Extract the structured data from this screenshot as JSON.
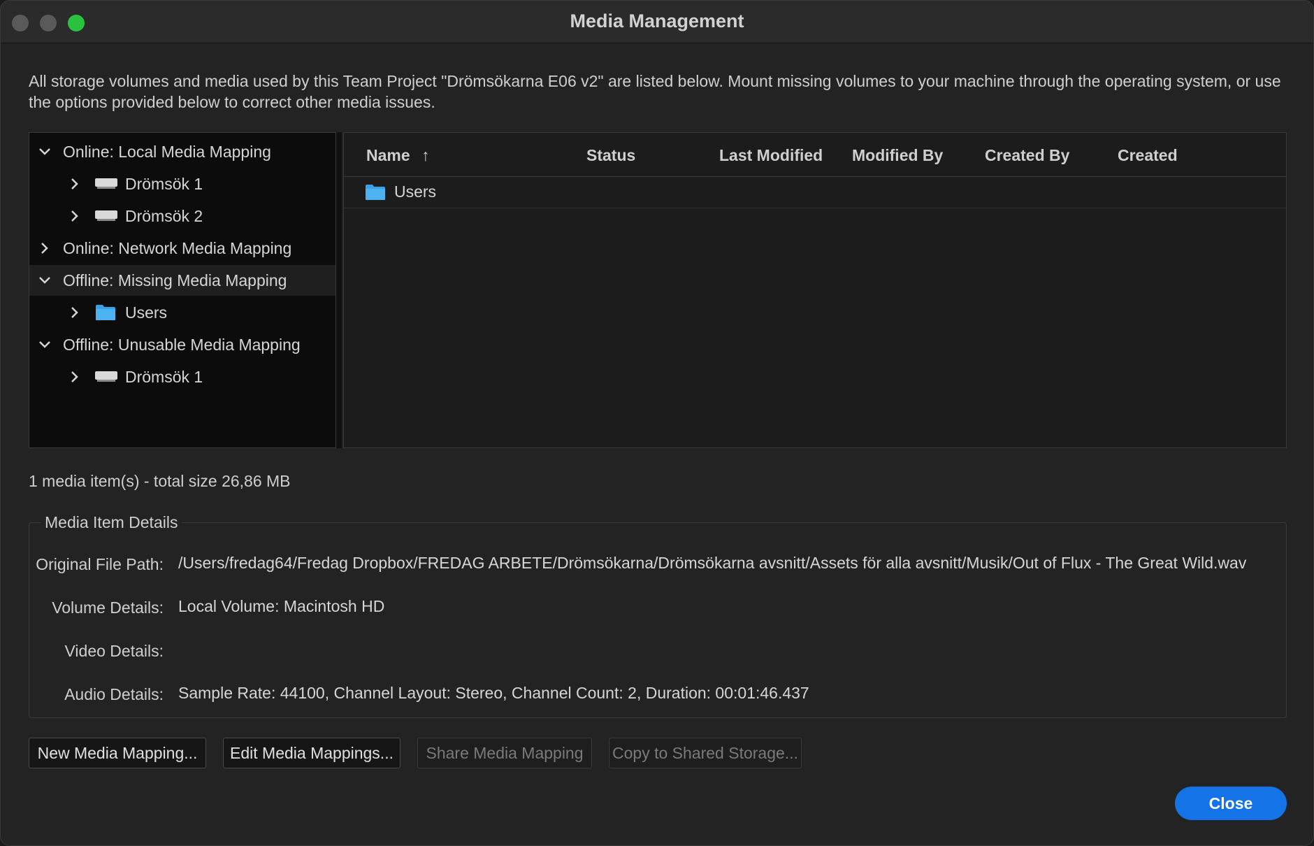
{
  "window": {
    "title": "Media Management"
  },
  "description": "All storage volumes and media used by this Team Project \"Drömsökarna E06 v2\" are listed below. Mount missing volumes to your machine through the operating system, or use the options provided below to correct other media issues.",
  "tree": {
    "groups": [
      {
        "label": "Online: Local Media Mapping",
        "expanded": true,
        "icon": "chevron-down-icon"
      },
      {
        "label": "Drömsök 1",
        "icon": "drive-icon"
      },
      {
        "label": "Drömsök 2",
        "icon": "drive-icon"
      },
      {
        "label": "Online: Network Media Mapping",
        "expanded": false,
        "icon": "chevron-right-icon"
      },
      {
        "label": "Offline: Missing Media Mapping",
        "expanded": true,
        "selected": true,
        "icon": "chevron-down-icon"
      },
      {
        "label": "Users",
        "icon": "folder-icon"
      },
      {
        "label": "Offline: Unusable Media Mapping",
        "expanded": true,
        "icon": "chevron-down-icon"
      },
      {
        "label": "Drömsök 1",
        "icon": "drive-icon"
      }
    ]
  },
  "table": {
    "columns": [
      "Name",
      "Status",
      "Last Modified",
      "Modified By",
      "Created By",
      "Created"
    ],
    "sort_indicator": "↑",
    "rows": [
      {
        "name": "Users",
        "icon": "folder-icon"
      }
    ]
  },
  "summary": "1 media item(s) - total size 26,86 MB",
  "details": {
    "legend": "Media Item Details",
    "original_file_path_label": "Original File Path:",
    "original_file_path": "/Users/fredag64/Fredag Dropbox/FREDAG ARBETE/Drömsökarna/Drömsökarna avsnitt/Assets för alla avsnitt/Musik/Out of Flux - The Great Wild.wav",
    "volume_details_label": "Volume Details:",
    "volume_details": "Local Volume: Macintosh HD",
    "video_details_label": "Video Details:",
    "video_details": "",
    "audio_details_label": "Audio Details:",
    "audio_details": "Sample Rate: 44100, Channel Layout: Stereo, Channel Count: 2, Duration: 00:01:46.437"
  },
  "buttons": {
    "new_mapping": "New Media Mapping...",
    "edit_mappings": "Edit Media Mappings...",
    "share_mapping": "Share Media Mapping",
    "copy_shared": "Copy to Shared Storage...",
    "close": "Close"
  },
  "colors": {
    "accent": "#1473e6",
    "folder": "#3aa0e8",
    "maximize": "#29c23f"
  }
}
